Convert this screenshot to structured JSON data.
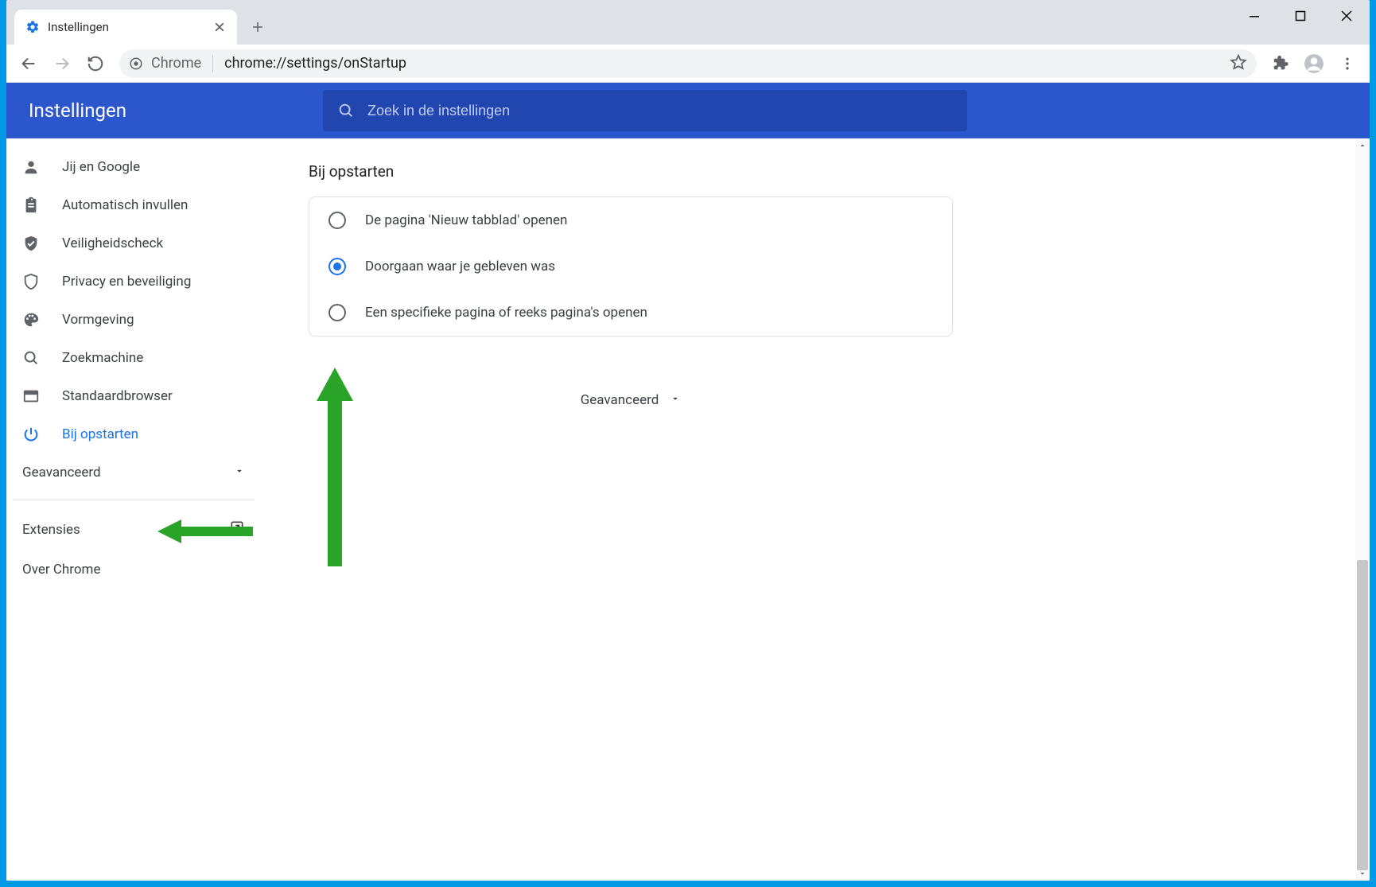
{
  "tab": {
    "title": "Instellingen"
  },
  "omnibox": {
    "scheme_label": "Chrome",
    "url_path": "chrome://settings/onStartup"
  },
  "settings_header": {
    "title": "Instellingen"
  },
  "search": {
    "placeholder": "Zoek in de instellingen"
  },
  "sidebar": {
    "items": [
      {
        "label": "Jij en Google"
      },
      {
        "label": "Automatisch invullen"
      },
      {
        "label": "Veiligheidscheck"
      },
      {
        "label": "Privacy en beveiliging"
      },
      {
        "label": "Vormgeving"
      },
      {
        "label": "Zoekmachine"
      },
      {
        "label": "Standaardbrowser"
      },
      {
        "label": "Bij opstarten"
      }
    ],
    "advanced": "Geavanceerd",
    "extensions": "Extensies",
    "about": "Over Chrome"
  },
  "main": {
    "section_title": "Bij opstarten",
    "radios": [
      {
        "label": "De pagina 'Nieuw tabblad' openen"
      },
      {
        "label": "Doorgaan waar je gebleven was"
      },
      {
        "label": "Een specifieke pagina of reeks pagina's openen"
      }
    ],
    "advanced_toggle": "Geavanceerd"
  },
  "colors": {
    "accent": "#1a73e8",
    "header": "#2c56cc",
    "annotation": "#2aa329"
  }
}
